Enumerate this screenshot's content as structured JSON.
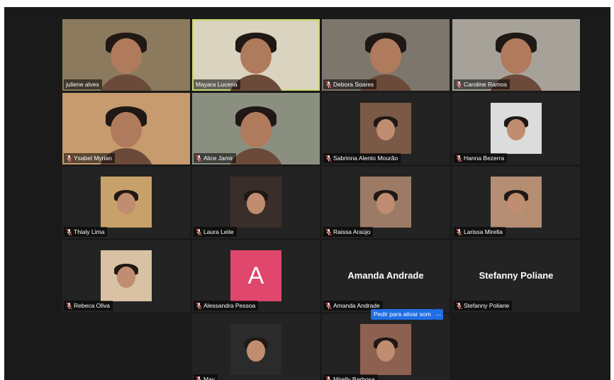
{
  "participants": [
    {
      "name": "juliene alves",
      "muted": false,
      "type": "video",
      "bg": "#8b7a5e"
    },
    {
      "name": "Mayara Lucena",
      "muted": false,
      "type": "video",
      "bg": "#d9d3bf",
      "active": true
    },
    {
      "name": "Debora Soares",
      "muted": true,
      "type": "video",
      "bg": "#7c766c"
    },
    {
      "name": "Caroline Ramos",
      "muted": true,
      "type": "video",
      "bg": "#a6a29a"
    },
    {
      "name": "Ysabel Myrian",
      "muted": true,
      "type": "video",
      "bg": "#c79b6e"
    },
    {
      "name": "Alice Jamir",
      "muted": true,
      "type": "video",
      "bg": "#8a8f80"
    },
    {
      "name": "Sabrinna Alento Mourão",
      "muted": true,
      "type": "photo",
      "photo": "#7a5a47"
    },
    {
      "name": "Hanna Bezerra",
      "muted": true,
      "type": "photo",
      "photo": "#dcdcdc"
    },
    {
      "name": "Thialy Lima",
      "muted": true,
      "type": "photo",
      "photo": "#c8a06a"
    },
    {
      "name": "Laura Leite",
      "muted": true,
      "type": "photo",
      "photo": "#3a2e2a"
    },
    {
      "name": "Raissa Araújo",
      "muted": true,
      "type": "photo",
      "photo": "#9c7b66"
    },
    {
      "name": "Larissa Mirella",
      "muted": true,
      "type": "photo",
      "photo": "#b48d72"
    },
    {
      "name": "Rebeca Oliva",
      "muted": true,
      "type": "photo",
      "photo": "#d8c2a3"
    },
    {
      "name": "Alessandra Pessoa",
      "muted": true,
      "type": "avatar",
      "letter": "A"
    },
    {
      "name": "Amanda Andrade",
      "muted": true,
      "type": "text",
      "display": "Amanda Andrade"
    },
    {
      "name": "Stefanny Poliane",
      "muted": true,
      "type": "text",
      "display": "Stefanny Poliane"
    },
    {
      "name": "May",
      "muted": true,
      "type": "photo",
      "photo": "#2b2b2b"
    },
    {
      "name": "Mirelly Barbosa",
      "muted": true,
      "type": "photo",
      "photo": "#8c6150"
    }
  ],
  "unmute_button": {
    "label": "Pedir para ativar som"
  },
  "more_button": {
    "label": "..."
  },
  "colors": {
    "accent_active": "#c8d96b",
    "button_blue": "#1f6fe6",
    "muted_red": "#e0413a"
  }
}
